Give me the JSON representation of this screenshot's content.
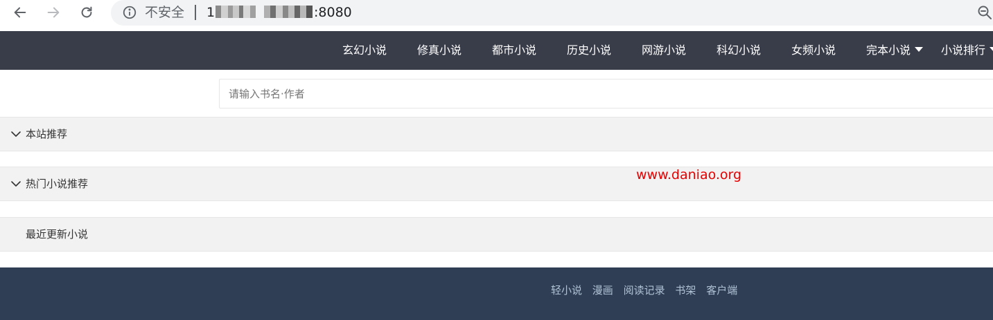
{
  "browser": {
    "security_label": "不安全",
    "url_prefix": "1",
    "url_port": ":8080"
  },
  "nav": {
    "items": [
      "玄幻小说",
      "修真小说",
      "都市小说",
      "历史小说",
      "网游小说",
      "科幻小说",
      "女频小说",
      "完本小说",
      "小说排行"
    ]
  },
  "search": {
    "placeholder": "请输入书名·作者",
    "value": ""
  },
  "sections": {
    "recommend": "本站推荐",
    "hot": "热门小说推荐",
    "latest": "最近更新小说"
  },
  "watermark": "www.daniao.org",
  "footer": {
    "links": [
      "轻小说",
      "漫画",
      "阅读记录",
      "书架",
      "客户端"
    ]
  },
  "colors": {
    "nav_bg": "#393d49",
    "footer_bg": "#2f3e54",
    "footer_link": "#b0c2d6",
    "watermark": "#e60000",
    "section_bg": "#f2f2f2"
  },
  "icons": {
    "back": "arrow-left-icon",
    "forward": "arrow-right-icon",
    "reload": "reload-icon",
    "info": "info-icon",
    "zoom": "zoom-out-icon",
    "section_toggle": "chevron-down-icon",
    "dropdown": "caret-down-icon"
  }
}
